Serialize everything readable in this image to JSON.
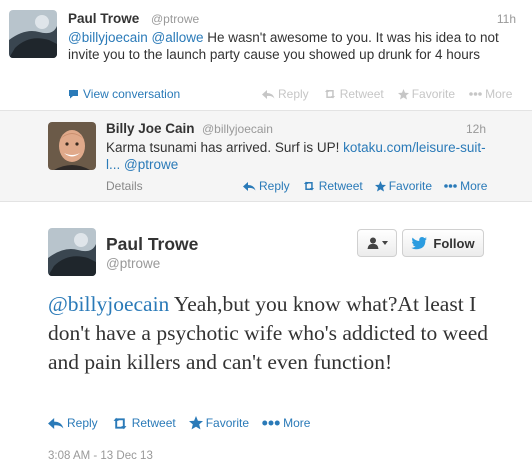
{
  "tweet1": {
    "author_name": "Paul Trowe",
    "author_handle": "@ptrowe",
    "time": "11h",
    "mention1": "@billyjoecain",
    "mention2": "@allowe",
    "text_rest": " He wasn't awesome to you.  It was his idea to not invite you to the launch party cause you showed up drunk for 4 hours",
    "view_conversation": "View conversation",
    "actions": {
      "reply": "Reply",
      "retweet": "Retweet",
      "favorite": "Favorite",
      "more": "More"
    }
  },
  "tweet2": {
    "author_name": "Billy Joe Cain",
    "author_handle": "@billyjoecain",
    "time": "12h",
    "text_pre": "Karma tsunami has arrived. Surf is UP!  ",
    "link": "kotaku.com/leisure-suit-l...",
    "mention": "@ptrowe",
    "details": "Details",
    "actions": {
      "reply": "Reply",
      "retweet": "Retweet",
      "favorite": "Favorite",
      "more": "More"
    }
  },
  "main_tweet": {
    "author_name": "Paul Trowe",
    "author_handle": "@ptrowe",
    "follow_label": "Follow",
    "mention": "@billyjoecain",
    "text_rest": " Yeah,but you know what?At least I don't have a psychotic wife who's addicted to weed and pain killers and can't even function!",
    "actions": {
      "reply": "Reply",
      "retweet": "Retweet",
      "favorite": "Favorite",
      "more": "More"
    },
    "timestamp": "3:08 AM - 13 Dec 13"
  },
  "colors": {
    "link": "#2a7ab8",
    "twitter_bird": "#2b9ce0",
    "muted_text": "#999999",
    "reply_background": "#f5f5f5"
  },
  "icons": [
    "reply-arrow-icon",
    "retweet-icon",
    "favorite-star-icon",
    "more-dots-icon",
    "speech-bubble-icon",
    "person-icon",
    "twitter-bird-icon"
  ]
}
